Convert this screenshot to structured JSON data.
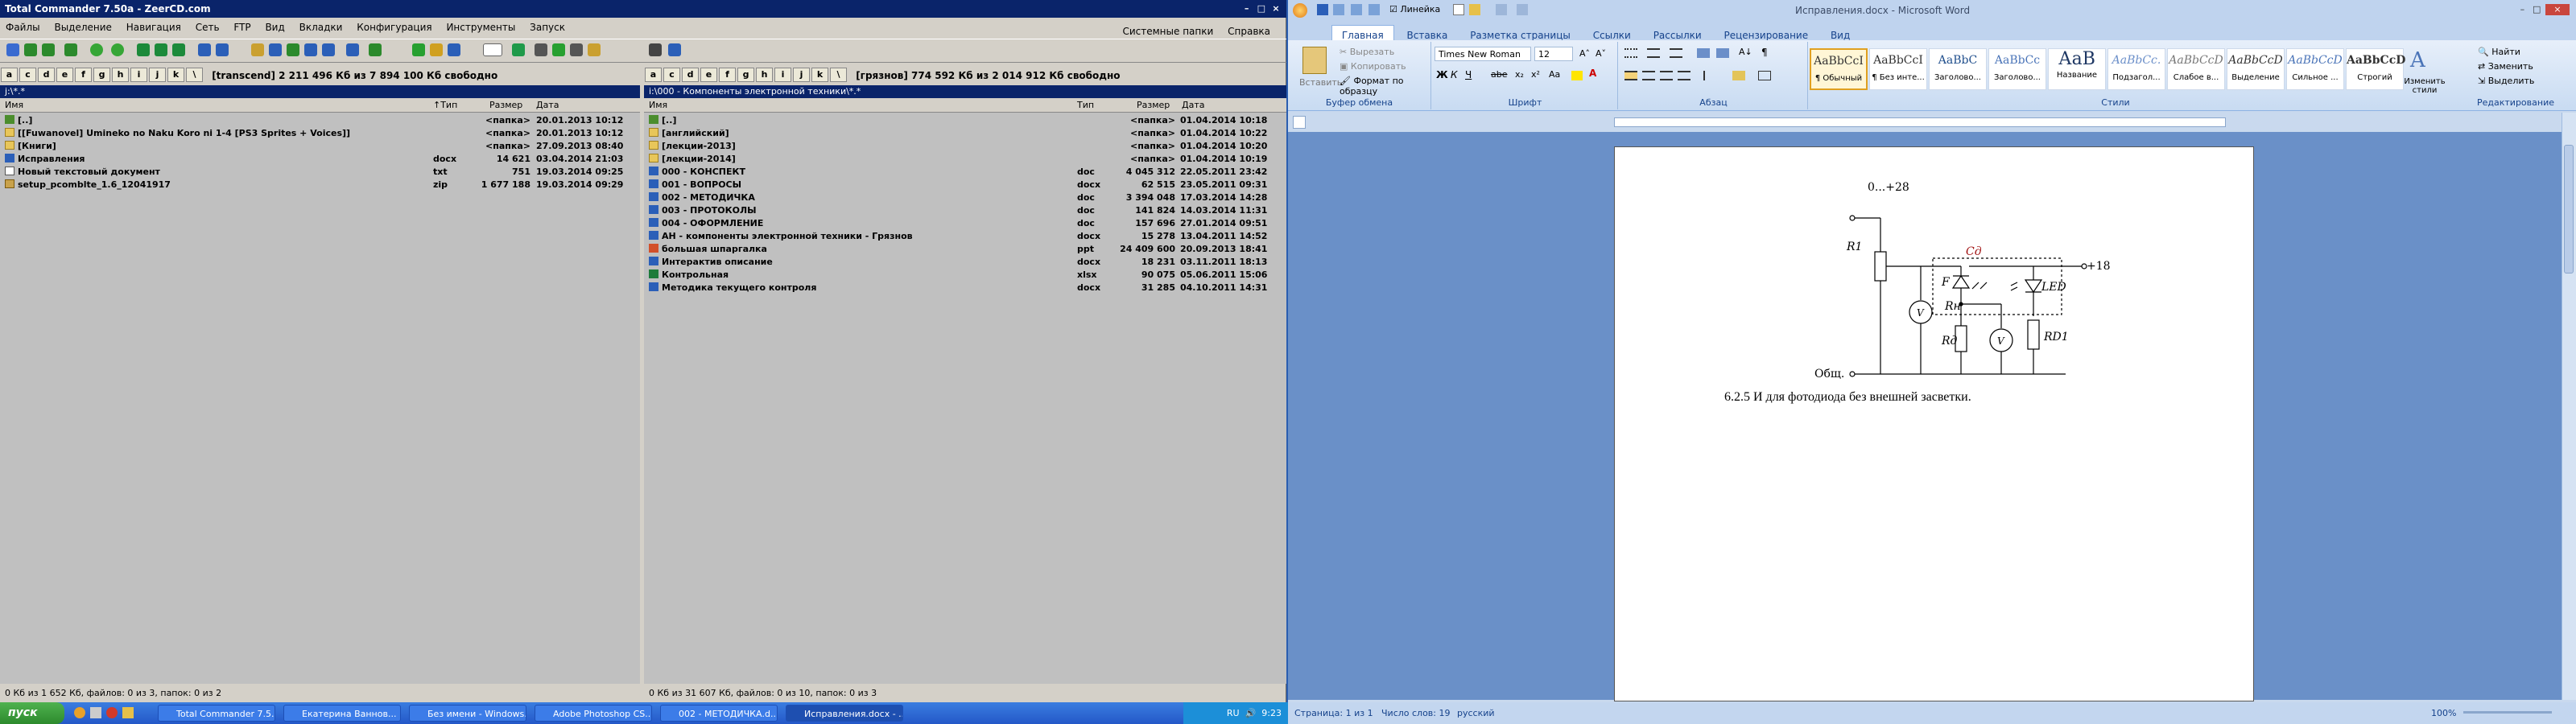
{
  "tc": {
    "title": "Total Commander 7.50a - ZeerCD.com",
    "menu": [
      "Файлы",
      "Выделение",
      "Навигация",
      "Сеть",
      "FTP",
      "Вид",
      "Вкладки",
      "Конфигурация",
      "Инструменты",
      "Запуск"
    ],
    "menu_right": [
      "Системные папки",
      "Справка"
    ],
    "left": {
      "drive_info": "[transcend]  2 211 496 Кб из 7 894 100 Кб свободно",
      "path": "j:\\*.*",
      "headers": {
        "name": "Имя",
        "type": "↑Тип",
        "size": "Размер",
        "date": "Дата"
      },
      "rows": [
        {
          "icon": "up",
          "name": "[..]",
          "type": "",
          "size": "<папка>",
          "date": "20.01.2013 10:12"
        },
        {
          "icon": "folder",
          "name": "[[Fuwanovel] Umineko no Naku Koro ni 1-4 [PS3 Sprites + Voices]]",
          "type": "",
          "size": "<папка>",
          "date": "20.01.2013 10:12"
        },
        {
          "icon": "folder",
          "name": "[Книги]",
          "type": "",
          "size": "<папка>",
          "date": "27.09.2013 08:40"
        },
        {
          "icon": "doc",
          "name": "Исправления",
          "type": "docx",
          "size": "14 621",
          "date": "03.04.2014 21:03"
        },
        {
          "icon": "txt",
          "name": "Новый текстовый документ",
          "type": "txt",
          "size": "751",
          "date": "19.03.2014 09:25"
        },
        {
          "icon": "zip",
          "name": "setup_pcomblte_1.6_12041917",
          "type": "zip",
          "size": "1 677 188",
          "date": "19.03.2014 09:29"
        }
      ],
      "status": "0 Кб из 1 652 Кб, файлов: 0 из 3, папок: 0 из 2"
    },
    "right": {
      "drive_info": "[грязнов]  774 592 Кб из 2 014 912 Кб свободно",
      "path": "i:\\000 - Компоненты электронной техники\\*.*",
      "headers": {
        "name": "Имя",
        "type": "Тип",
        "size": "Размер",
        "date": "Дата"
      },
      "rows": [
        {
          "icon": "up",
          "name": "[..]",
          "type": "",
          "size": "<папка>",
          "date": "01.04.2014 10:18"
        },
        {
          "icon": "folder",
          "name": "[английский]",
          "type": "",
          "size": "<папка>",
          "date": "01.04.2014 10:22"
        },
        {
          "icon": "folder",
          "name": "[лекции-2013]",
          "type": "",
          "size": "<папка>",
          "date": "01.04.2014 10:20"
        },
        {
          "icon": "folder",
          "name": "[лекции-2014]",
          "type": "",
          "size": "<папка>",
          "date": "01.04.2014 10:19"
        },
        {
          "icon": "doc",
          "name": "000 - КОНСПЕКТ",
          "type": "doc",
          "size": "4 045 312",
          "date": "22.05.2011 23:42"
        },
        {
          "icon": "doc",
          "name": "001 - ВОПРОСЫ",
          "type": "docx",
          "size": "62 515",
          "date": "23.05.2011 09:31"
        },
        {
          "icon": "doc",
          "name": "002 - МЕТОДИЧКА",
          "type": "doc",
          "size": "3 394 048",
          "date": "17.03.2014 14:28"
        },
        {
          "icon": "doc",
          "name": "003 - ПРОТОКОЛЫ",
          "type": "doc",
          "size": "141 824",
          "date": "14.03.2014 11:31"
        },
        {
          "icon": "doc",
          "name": "004 - ОФОРМЛЕНИЕ",
          "type": "doc",
          "size": "157 696",
          "date": "27.01.2014 09:51"
        },
        {
          "icon": "doc",
          "name": "АН - компоненты электронной техники - Грязнов",
          "type": "docx",
          "size": "15 278",
          "date": "13.04.2011 14:52"
        },
        {
          "icon": "ppt",
          "name": "большая шпаргалка",
          "type": "ppt",
          "size": "24 409 600",
          "date": "20.09.2013 18:41"
        },
        {
          "icon": "doc",
          "name": "Интерактив описание",
          "type": "docx",
          "size": "18 231",
          "date": "03.11.2011 18:13"
        },
        {
          "icon": "xls",
          "name": "Контрольная",
          "type": "xlsx",
          "size": "90 075",
          "date": "05.06.2011 15:06"
        },
        {
          "icon": "doc",
          "name": "Методика текущего контроля",
          "type": "docx",
          "size": "31 285",
          "date": "04.10.2011 14:31"
        }
      ],
      "status": "0 Кб из 31 607 Кб, файлов: 0 из 10, папок: 0 из 3"
    }
  },
  "word": {
    "title": "Исправления.docx - Microsoft Word",
    "quick_ruler_label": "Линейка",
    "tabs": [
      "Главная",
      "Вставка",
      "Разметка страницы",
      "Ссылки",
      "Рассылки",
      "Рецензирование",
      "Вид"
    ],
    "clipboard": {
      "paste": "Вставить",
      "cut": "Вырезать",
      "copy": "Копировать",
      "format_painter": "Формат по образцу",
      "label": "Буфер обмена"
    },
    "font": {
      "name": "Times New Roman",
      "size": "12",
      "label": "Шрифт"
    },
    "paragraph_label": "Абзац",
    "styles": [
      {
        "sample": "AaBbCcI",
        "name": "¶ Обычный"
      },
      {
        "sample": "AaBbCcI",
        "name": "¶ Без инте..."
      },
      {
        "sample": "AaBbC",
        "name": "Заголово..."
      },
      {
        "sample": "AaBbCc",
        "name": "Заголово..."
      },
      {
        "sample": "АаВ",
        "name": "Название"
      },
      {
        "sample": "AaBbCc.",
        "name": "Подзагол..."
      },
      {
        "sample": "AaBbCcD",
        "name": "Слабое в..."
      },
      {
        "sample": "AaBbCcD",
        "name": "Выделение"
      },
      {
        "sample": "AaBbCcD",
        "name": "Сильное ..."
      },
      {
        "sample": "AaBbCcD",
        "name": "Строгий"
      }
    ],
    "styles_label": "Стили",
    "change_styles": "Изменить стили",
    "editing": {
      "find": "Найти",
      "replace": "Заменить",
      "select": "Выделить",
      "label": "Редактирование"
    },
    "doc": {
      "circuit_labels": {
        "top_range": "0...+28",
        "r1": "R1",
        "cd": "Cд",
        "plus18": "+18",
        "f": "F",
        "led": "LED",
        "rn": "Rн",
        "rd": "Rд",
        "rd1": "RD1",
        "v": "V",
        "common": "Общ."
      },
      "paragraph": "6.2.5 И для фотодиода без внешней засветки."
    },
    "status": {
      "page": "Страница: 1 из 1",
      "words": "Число слов: 19",
      "lang": "русский",
      "zoom": "100%"
    }
  },
  "taskbar": {
    "start": "пуск",
    "tasks": [
      "Total Commander 7.5...",
      "Екатерина Ваннов...",
      "Без имени - Windows...",
      "Adobe Photoshop CS...",
      "002 - МЕТОДИЧКА.d...",
      "Исправления.docx - ..."
    ],
    "clock": "9:23",
    "lang": "RU"
  }
}
